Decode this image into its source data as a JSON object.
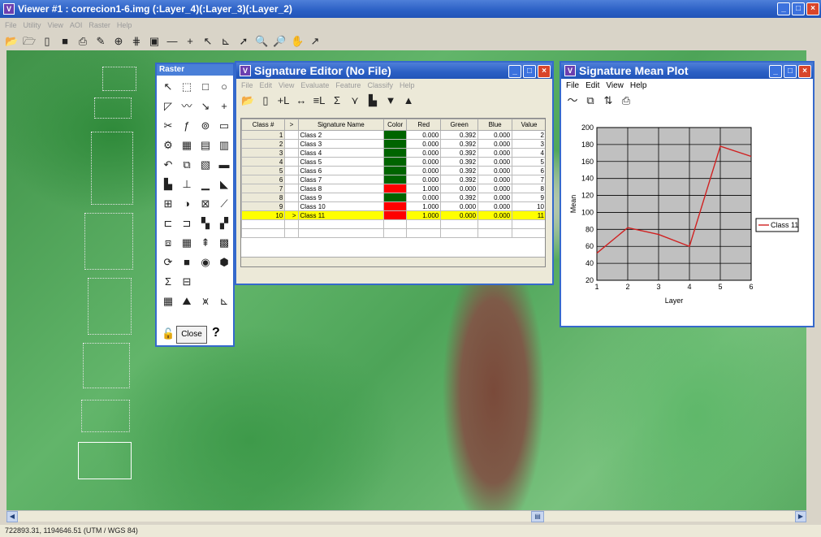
{
  "viewer": {
    "title": "Viewer #1 : correcion1-6.img (:Layer_4)(:Layer_3)(:Layer_2)",
    "menus": [
      "File",
      "Utility",
      "View",
      "AOI",
      "Raster",
      "Help"
    ],
    "status_text": "722893.31, 1194646.51  (UTM / WGS 84)"
  },
  "raster_palette": {
    "title": "Raster",
    "close_label": "Close",
    "help_label": "?"
  },
  "sig_editor": {
    "title": "Signature Editor (No File)",
    "menus": [
      "File",
      "Edit",
      "View",
      "Evaluate",
      "Feature",
      "Classify",
      "Help"
    ],
    "columns": [
      "Class #",
      ">",
      "Signature Name",
      "Color",
      "Red",
      "Green",
      "Blue",
      "Value"
    ],
    "rows": [
      {
        "num": "1",
        "marker": "",
        "name": "Class 2",
        "color": "#006400",
        "red": "0.000",
        "green": "0.392",
        "blue": "0.000",
        "value": "2"
      },
      {
        "num": "2",
        "marker": "",
        "name": "Class 3",
        "color": "#006400",
        "red": "0.000",
        "green": "0.392",
        "blue": "0.000",
        "value": "3"
      },
      {
        "num": "3",
        "marker": "",
        "name": "Class 4",
        "color": "#006400",
        "red": "0.000",
        "green": "0.392",
        "blue": "0.000",
        "value": "4"
      },
      {
        "num": "4",
        "marker": "",
        "name": "Class 5",
        "color": "#006400",
        "red": "0.000",
        "green": "0.392",
        "blue": "0.000",
        "value": "5"
      },
      {
        "num": "5",
        "marker": "",
        "name": "Class 6",
        "color": "#006400",
        "red": "0.000",
        "green": "0.392",
        "blue": "0.000",
        "value": "6"
      },
      {
        "num": "6",
        "marker": "",
        "name": "Class 7",
        "color": "#006400",
        "red": "0.000",
        "green": "0.392",
        "blue": "0.000",
        "value": "7"
      },
      {
        "num": "7",
        "marker": "",
        "name": "Class 8",
        "color": "#ff0000",
        "red": "1.000",
        "green": "0.000",
        "blue": "0.000",
        "value": "8"
      },
      {
        "num": "8",
        "marker": "",
        "name": "Class 9",
        "color": "#006400",
        "red": "0.000",
        "green": "0.392",
        "blue": "0.000",
        "value": "9"
      },
      {
        "num": "9",
        "marker": "",
        "name": "Class 10",
        "color": "#ff0000",
        "red": "1.000",
        "green": "0.000",
        "blue": "0.000",
        "value": "10"
      },
      {
        "num": "10",
        "marker": ">",
        "name": "Class 11",
        "color": "#ff0000",
        "red": "1.000",
        "green": "0.000",
        "blue": "0.000",
        "value": "11",
        "selected": true
      }
    ]
  },
  "plot_win": {
    "title": "Signature Mean Plot",
    "menus": [
      "File",
      "Edit",
      "View",
      "Help"
    ]
  },
  "chart_data": {
    "type": "line",
    "title": "",
    "xlabel": "Layer",
    "ylabel": "Mean",
    "x": [
      1,
      2,
      3,
      4,
      5,
      6
    ],
    "xlim": [
      1,
      6
    ],
    "ylim": [
      20,
      200
    ],
    "x_ticks": [
      "1",
      "2",
      "3",
      "4",
      "5",
      "6"
    ],
    "y_ticks": [
      "20",
      "40",
      "60",
      "80",
      "100",
      "120",
      "140",
      "160",
      "180",
      "200"
    ],
    "grid": true,
    "legend": "right",
    "series": [
      {
        "name": "Class 11",
        "color": "#d02020",
        "values": [
          52,
          82,
          74,
          60,
          178,
          166
        ]
      }
    ]
  }
}
